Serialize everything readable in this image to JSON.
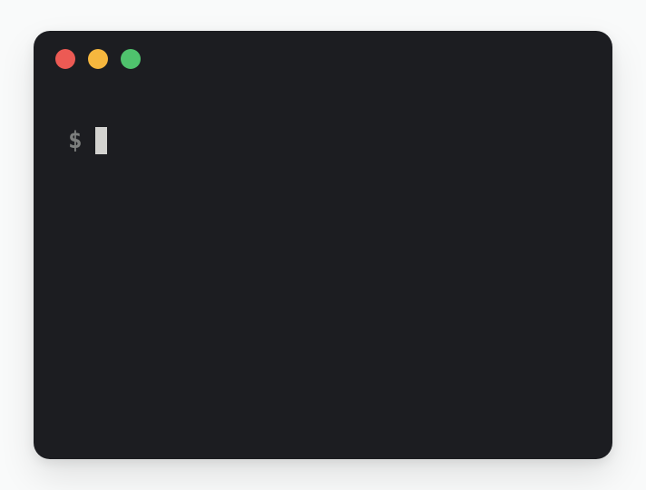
{
  "prompt": {
    "symbol": "$",
    "input": ""
  },
  "colors": {
    "close": "#ec5a54",
    "minimize": "#f6b73e",
    "maximize": "#4fc36d",
    "background": "#1c1d21",
    "cursor": "#d3d3d0"
  }
}
